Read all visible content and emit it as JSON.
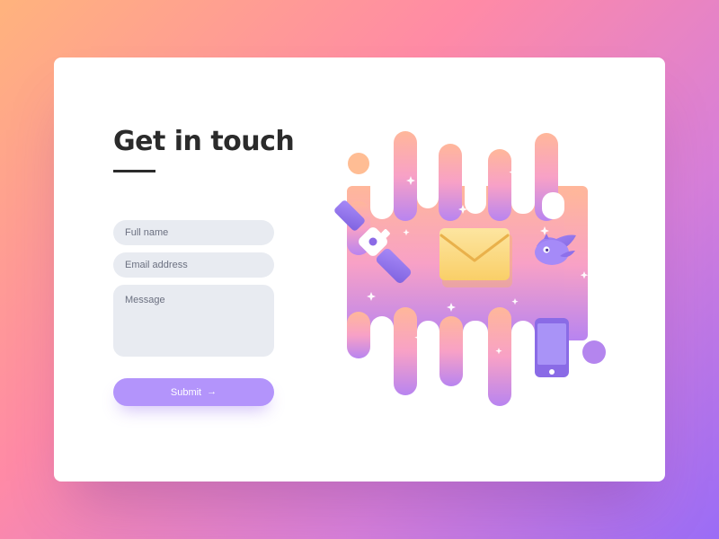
{
  "contact": {
    "title": "Get in touch",
    "form": {
      "full_name_placeholder": "Full name",
      "email_placeholder": "Email address",
      "message_placeholder": "Message",
      "submit_label": "Submit"
    },
    "icons": [
      "envelope-icon",
      "satellite-icon",
      "bird-icon",
      "phone-icon",
      "sparkle-icon",
      "arrow-right-icon"
    ]
  },
  "colors": {
    "background_start": "#ffb37d",
    "background_end": "#9a6cf6",
    "card": "#ffffff",
    "field": "#e8ebf1",
    "button": "#b394fb",
    "title": "#2b2b2b"
  }
}
